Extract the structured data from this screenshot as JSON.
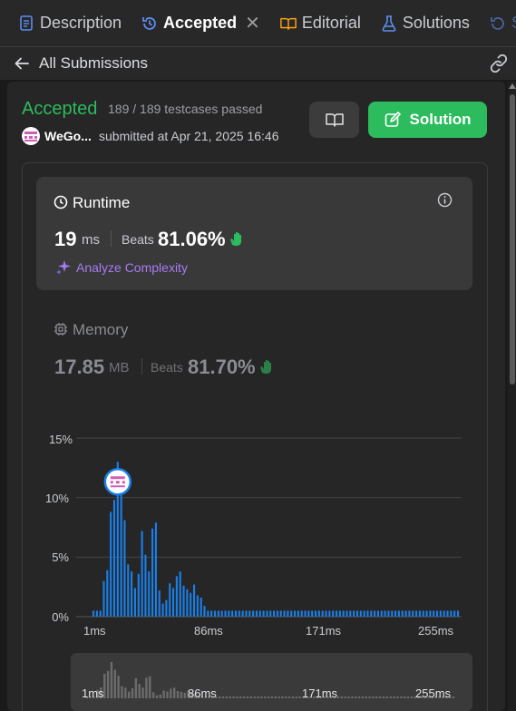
{
  "tabs": [
    {
      "label": "Description",
      "icon": "description-icon",
      "color": "#5b8def"
    },
    {
      "label": "Accepted",
      "icon": "history-icon",
      "color": "#5b8def",
      "active": true
    },
    {
      "label": "Editorial",
      "icon": "book-icon",
      "color": "#ffa116"
    },
    {
      "label": "Solutions",
      "icon": "flask-icon",
      "color": "#5b8def"
    },
    {
      "label": "S",
      "icon": "history-icon",
      "color": "#5b8def"
    }
  ],
  "subbar": {
    "back_label": "All Submissions"
  },
  "submission": {
    "status": "Accepted",
    "testcases": "189 / 189 testcases passed",
    "user": "WeGo...",
    "submitted": "submitted at Apr 21, 2025 16:46",
    "solution_label": "Solution"
  },
  "runtime": {
    "title": "Runtime",
    "value": "19",
    "unit": "ms",
    "beats_label": "Beats",
    "beats_value": "81.06%",
    "analyze_label": "Analyze Complexity"
  },
  "memory": {
    "title": "Memory",
    "value": "17.85",
    "unit": "MB",
    "beats_label": "Beats",
    "beats_value": "81.70%"
  },
  "colors": {
    "accent_green": "#2cbb5d",
    "bar_blue": "#1a7fe8",
    "purple": "#a77bf3"
  },
  "chart_data": {
    "type": "bar",
    "y_ticks": [
      "15%",
      "10%",
      "5%",
      "0%"
    ],
    "x_ticks": [
      "1ms",
      "86ms",
      "171ms",
      "255ms"
    ],
    "ylim": [
      0,
      15
    ],
    "values": [
      0.5,
      0.5,
      0.5,
      3,
      3.9,
      8.8,
      9.8,
      13,
      10.2,
      8.1,
      4.4,
      3.8,
      2.4,
      3.6,
      7.2,
      5.2,
      3.8,
      7.4,
      7.9,
      2.2,
      1.1,
      1.4,
      2.8,
      2.4,
      3.4,
      3.8,
      2.6,
      2.3,
      2,
      2.7,
      1.8,
      1.6,
      0.9,
      0.5,
      0.5,
      0.5,
      0.5,
      0.5,
      0.5,
      0.5,
      0.5,
      0.5,
      0.5,
      0.5,
      0.5,
      0.5,
      0.5,
      0.5,
      0.5,
      0.5,
      0.5,
      0.5,
      0.5,
      0.5,
      0.5,
      0.5,
      0.5,
      0.5,
      0.5,
      0.5,
      0.5,
      0.5,
      0.5,
      0.5,
      0.5,
      0.5,
      0.5,
      0.5,
      0.5,
      0.5,
      0.5,
      0.5,
      0.5,
      0.5,
      0.5,
      0.5,
      0.5,
      0.5,
      0.5,
      0.5,
      0.5,
      0.5,
      0.5,
      0.5,
      0.5,
      0.5,
      0.5,
      0.5,
      0.5,
      0.5,
      0.5,
      0.5,
      0.5,
      0.5,
      0.5,
      0.5,
      0.5,
      0.5,
      0.5,
      0.5,
      0.5,
      0.5,
      0.5,
      0.5,
      0.5,
      0.5
    ],
    "highlight_index": 7,
    "mini_x_ticks": [
      "1ms",
      "86ms",
      "171ms",
      "255ms"
    ]
  }
}
